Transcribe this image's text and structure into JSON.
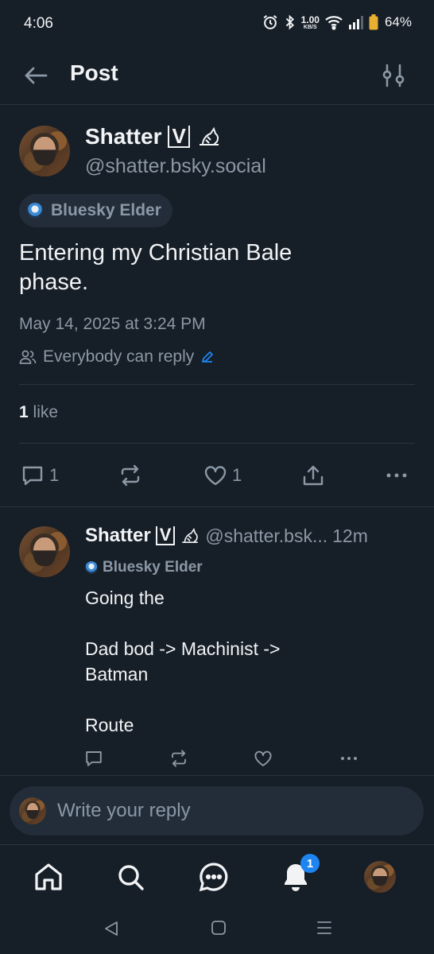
{
  "status_bar": {
    "time": "4:06",
    "speed_value": "1.00",
    "speed_unit": "KB/S",
    "battery": "64%"
  },
  "header": {
    "title": "Post"
  },
  "post": {
    "author_name": "Shatter",
    "author_badge": "V",
    "handle": "@shatter.bsky.social",
    "badge_label": "Bluesky Elder",
    "text_line1": "Entering my Christian Bale",
    "text_line2": "phase.",
    "date": "May 14, 2025 at 3:24 PM",
    "reply_setting": "Everybody can reply",
    "likes_count": "1",
    "likes_label": "like",
    "actions": {
      "reply_count": "1",
      "like_count": "1"
    }
  },
  "reply": {
    "author_name": "Shatter",
    "author_badge": "V",
    "handle": "@shatter.bsk...",
    "time": "12m",
    "badge_label": "Bluesky Elder",
    "line1": "Going the",
    "line2": "Dad bod -> Machinist ->",
    "line3": "Batman",
    "line4": "Route"
  },
  "composer": {
    "placeholder": "Write your reply"
  },
  "tabbar": {
    "notification_count": "1"
  },
  "colors": {
    "background": "#161e27",
    "surface": "#222d39",
    "muted_text": "#8b98a5",
    "accent": "#1d84f0"
  }
}
